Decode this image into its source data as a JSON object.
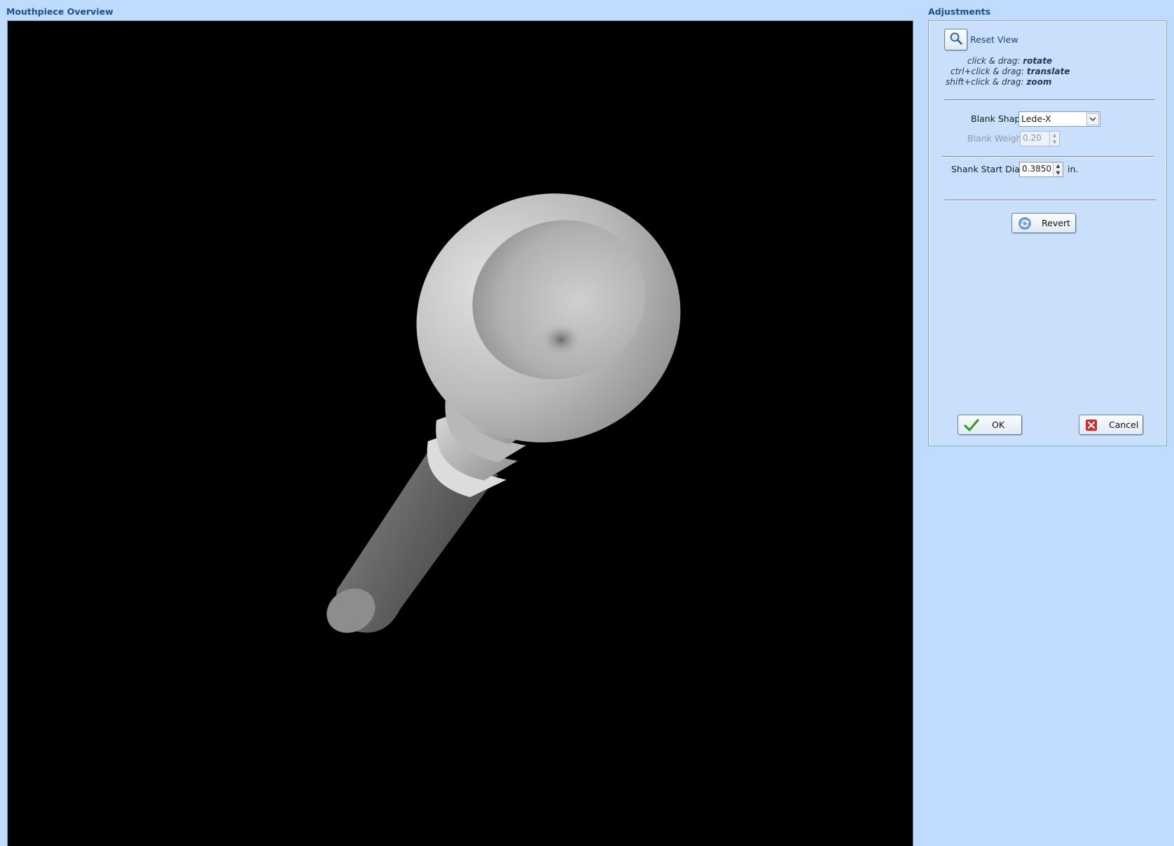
{
  "overview": {
    "title": "Mouthpiece Overview"
  },
  "adjustments": {
    "title": "Adjustments",
    "reset_view_label": "Reset View",
    "hints": [
      {
        "prefix": "click & drag:",
        "action": "rotate"
      },
      {
        "prefix": "ctrl+click & drag:",
        "action": "translate"
      },
      {
        "prefix": "shift+click & drag:",
        "action": "zoom"
      }
    ],
    "blank_shape": {
      "label": "Blank Shape",
      "value": "Lede-X"
    },
    "blank_weight": {
      "label": "Blank Weight",
      "value": "0.20"
    },
    "shank_start": {
      "label": "Shank Start Diam.",
      "value": "0.3850",
      "unit": "in."
    },
    "revert_label": "Revert",
    "ok_label": "OK",
    "cancel_label": "Cancel"
  },
  "icons": {
    "reset_view": "magnifier-icon",
    "revert": "refresh-icon",
    "ok": "checkmark-icon",
    "cancel": "close-icon"
  },
  "colors": {
    "background": "#bfdbfd",
    "panel": "#c8e0fb",
    "title_text": "#1f4f8f",
    "viewport": "#000000"
  }
}
